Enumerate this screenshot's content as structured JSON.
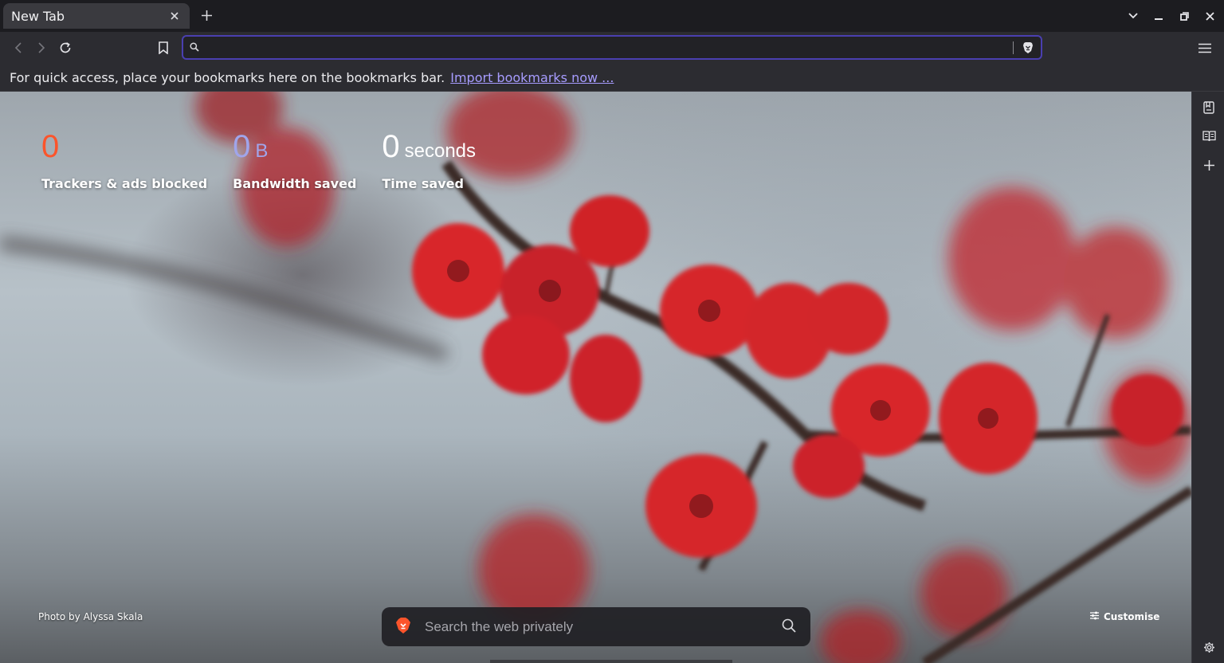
{
  "tabs": [
    {
      "title": "New Tab"
    }
  ],
  "window_controls": [
    "chevron-down-icon",
    "minimize-icon",
    "restore-icon",
    "close-icon"
  ],
  "url_bar": {
    "value": "",
    "placeholder": ""
  },
  "bookmarks_bar": {
    "message": "For quick access, place your bookmarks here on the bookmarks bar.",
    "import_link": "Import bookmarks now ..."
  },
  "stats": [
    {
      "number": "0",
      "unit": "",
      "label": "Trackers & ads blocked",
      "color": "#fb542b"
    },
    {
      "number": "0",
      "unit": "B",
      "label": "Bandwidth saved",
      "color": "#a0a5eb"
    },
    {
      "number": "0",
      "unit": "seconds",
      "label": "Time saved",
      "color": "#ffffff"
    }
  ],
  "photo_credit": "Photo by Alyssa Skala",
  "search": {
    "placeholder": "Search the web privately"
  },
  "customise_label": "Customise",
  "colors": {
    "accent": "#4a3fb0",
    "link": "#a79cff",
    "brave_orange": "#fb542b"
  },
  "sidebar_icons": [
    "reading-list-icon",
    "bookmarks-icon",
    "add-icon",
    "settings-icon"
  ]
}
